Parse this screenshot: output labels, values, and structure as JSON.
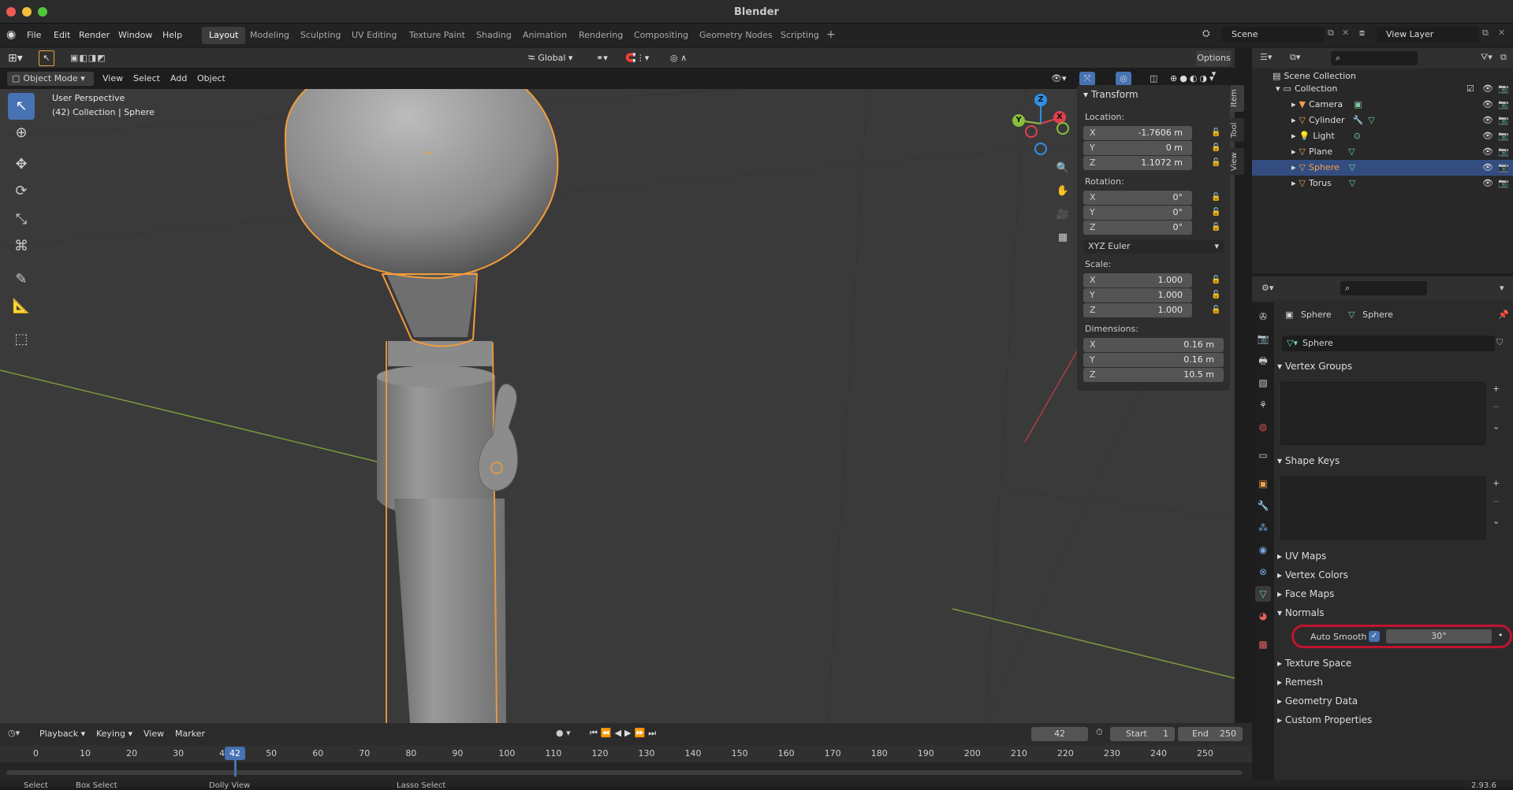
{
  "app": {
    "title": "Blender",
    "version": "2.93.6"
  },
  "menu": [
    "File",
    "Edit",
    "Render",
    "Window",
    "Help"
  ],
  "workspaces": [
    "Layout",
    "Modeling",
    "Sculpting",
    "UV Editing",
    "Texture Paint",
    "Shading",
    "Animation",
    "Rendering",
    "Compositing",
    "Geometry Nodes",
    "Scripting"
  ],
  "active_workspace": "Layout",
  "scene": {
    "name": "Scene",
    "view_layer": "View Layer"
  },
  "viewport_header": {
    "mode": "Object Mode",
    "menus": [
      "View",
      "Select",
      "Add",
      "Object"
    ],
    "orientation": "Global",
    "options": "Options"
  },
  "viewport": {
    "perspective": "User Perspective",
    "info": "(42) Collection | Sphere"
  },
  "npanel": {
    "tabs": [
      "Item",
      "Tool",
      "View"
    ],
    "title": "Transform",
    "location_label": "Location:",
    "location": [
      {
        "axis": "X",
        "value": "-1.7606 m"
      },
      {
        "axis": "Y",
        "value": "0 m"
      },
      {
        "axis": "Z",
        "value": "1.1072 m"
      }
    ],
    "rotation_label": "Rotation:",
    "rotation": [
      {
        "axis": "X",
        "value": "0°"
      },
      {
        "axis": "Y",
        "value": "0°"
      },
      {
        "axis": "Z",
        "value": "0°"
      }
    ],
    "rotation_mode": "XYZ Euler",
    "scale_label": "Scale:",
    "scale": [
      {
        "axis": "X",
        "value": "1.000"
      },
      {
        "axis": "Y",
        "value": "1.000"
      },
      {
        "axis": "Z",
        "value": "1.000"
      }
    ],
    "dimensions_label": "Dimensions:",
    "dimensions": [
      {
        "axis": "X",
        "value": "0.16 m"
      },
      {
        "axis": "Y",
        "value": "0.16 m"
      },
      {
        "axis": "Z",
        "value": "10.5 m"
      }
    ]
  },
  "outliner": {
    "root": "Scene Collection",
    "collection": "Collection",
    "items": [
      "Camera",
      "Cylinder",
      "Light",
      "Plane",
      "Sphere",
      "Torus"
    ],
    "selected": "Sphere"
  },
  "properties": {
    "object_name": "Sphere",
    "data_name": "Sphere",
    "mesh_name": "Sphere",
    "sections": {
      "vertex_groups": "Vertex Groups",
      "shape_keys": "Shape Keys",
      "uv_maps": "UV Maps",
      "vertex_colors": "Vertex Colors",
      "face_maps": "Face Maps",
      "normals": "Normals",
      "texture_space": "Texture Space",
      "remesh": "Remesh",
      "geometry_data": "Geometry Data",
      "custom_properties": "Custom Properties"
    },
    "auto_smooth_label": "Auto Smooth",
    "auto_smooth_checked": true,
    "auto_smooth_angle": "30°"
  },
  "timeline": {
    "menus": [
      "Playback",
      "Keying",
      "View",
      "Marker"
    ],
    "current_frame": "42",
    "start_label": "Start",
    "start": "1",
    "end_label": "End",
    "end": "250",
    "ticks": [
      "0",
      "10",
      "20",
      "30",
      "40",
      "50",
      "60",
      "70",
      "80",
      "90",
      "100",
      "110",
      "120",
      "130",
      "140",
      "150",
      "160",
      "170",
      "180",
      "190",
      "200",
      "210",
      "220",
      "230",
      "240",
      "250"
    ]
  },
  "statusbar": [
    "Select",
    "Box Select",
    "Dolly View",
    "Lasso Select"
  ],
  "colors": {
    "accent": "#4772b3",
    "selection": "#f5a04a",
    "highlight_ring": "#c0142e",
    "x_axis": "#e0414f",
    "y_axis": "#8bbf3b",
    "z_axis": "#2f8fe6"
  }
}
